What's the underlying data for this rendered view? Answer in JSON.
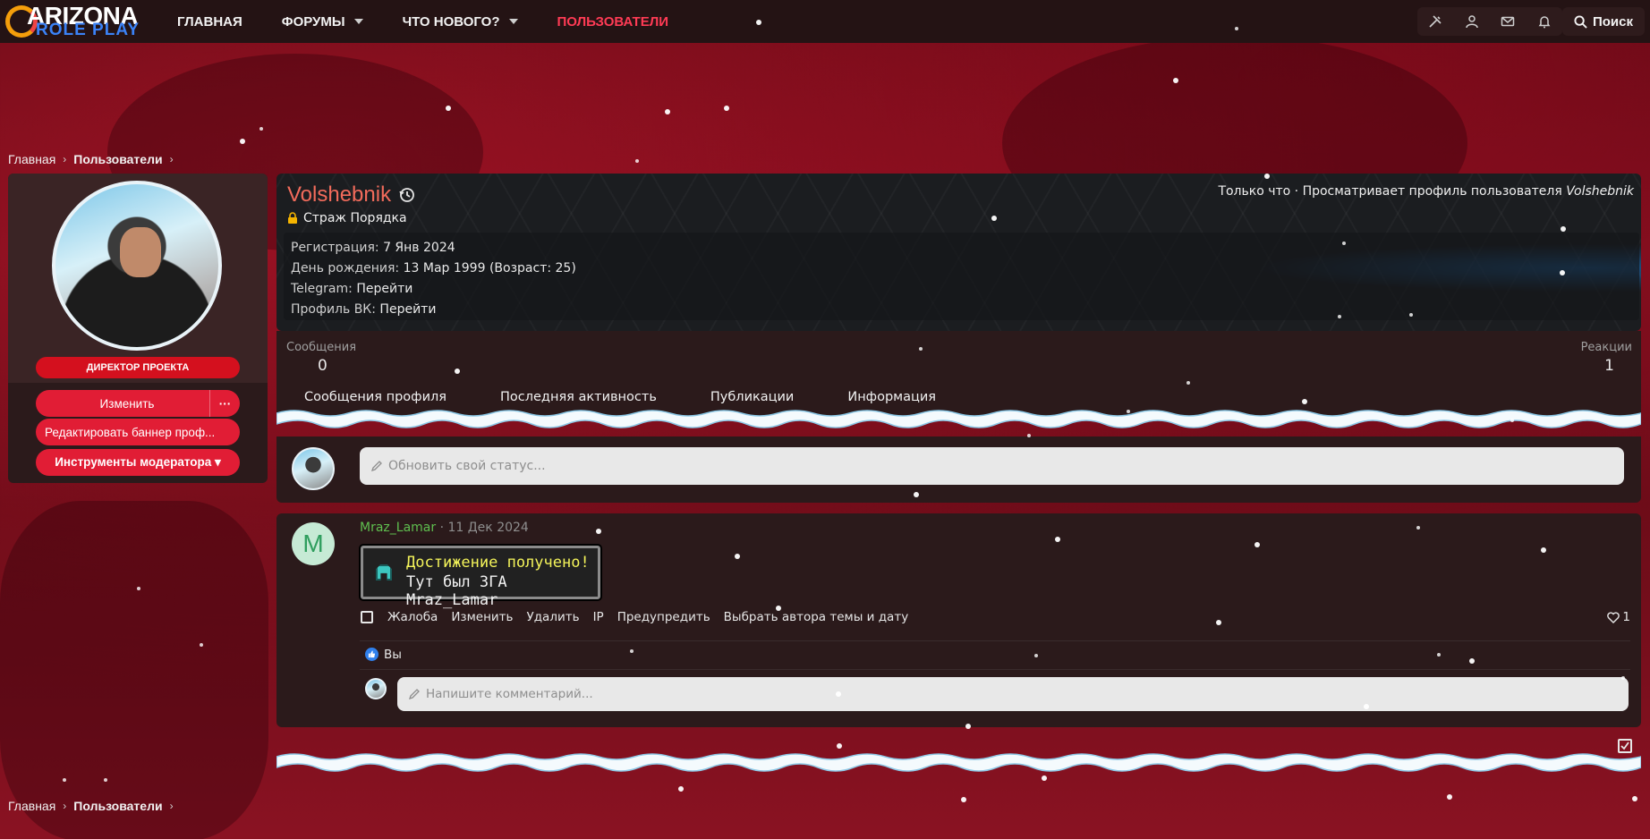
{
  "logo": {
    "line1": "ARIZONA",
    "line2": "ROLE PLAY"
  },
  "nav": {
    "items": [
      {
        "label": "ГЛАВНАЯ"
      },
      {
        "label": "ФОРУМЫ"
      },
      {
        "label": "ЧТО НОВОГО?"
      },
      {
        "label": "ПОЛЬЗОВАТЕЛИ"
      }
    ],
    "search_label": "Поиск",
    "accent_color": "#ff3b55"
  },
  "breadcrumb": {
    "home": "Главная",
    "section": "Пользователи"
  },
  "sidebar": {
    "role_badge": "ДИРЕКТОР ПРОЕКТА",
    "edit_label": "Изменить",
    "more_label": "···",
    "edit_banner_label": "Редактировать баннер проф...",
    "mod_tools_label": "Инструменты модератора ▾"
  },
  "profile": {
    "username": "Volshebnik",
    "user_title": "Страж Порядка",
    "activity_prefix": "Только что · Просматривает профиль пользователя",
    "activity_target": "Volshebnik",
    "info": [
      {
        "key": "Регистрация:",
        "value": "7 Янв 2024"
      },
      {
        "key": "День рождения:",
        "value": "13 Мар 1999 (Возраст: 25)"
      },
      {
        "key": "Telegram:",
        "value": "Перейти"
      },
      {
        "key": "Профиль ВК:",
        "value": "Перейти"
      }
    ],
    "stats": {
      "messages_label": "Сообщения",
      "messages_value": "0",
      "reactions_label": "Реакции",
      "reactions_value": "1"
    },
    "tabs": [
      {
        "label": "Сообщения профиля"
      },
      {
        "label": "Последняя активность"
      },
      {
        "label": "Публикации"
      },
      {
        "label": "Информация"
      }
    ]
  },
  "status": {
    "placeholder": "Обновить свой статус..."
  },
  "post": {
    "avatar_letter": "M",
    "author": "Mraz_Lamar",
    "date": "· 11 Дек 2024",
    "achievement_title": "Достижение получено!",
    "achievement_text": "Тут был ЗГА Mraz_Lamar",
    "actions": [
      {
        "label": "Жалоба"
      },
      {
        "label": "Изменить"
      },
      {
        "label": "Удалить"
      },
      {
        "label": "IP"
      },
      {
        "label": "Предупредить"
      },
      {
        "label": "Выбрать автора темы и дату"
      }
    ],
    "like_count": "1",
    "reacted_by": "Вы",
    "comment_placeholder": "Напишите комментарий..."
  }
}
